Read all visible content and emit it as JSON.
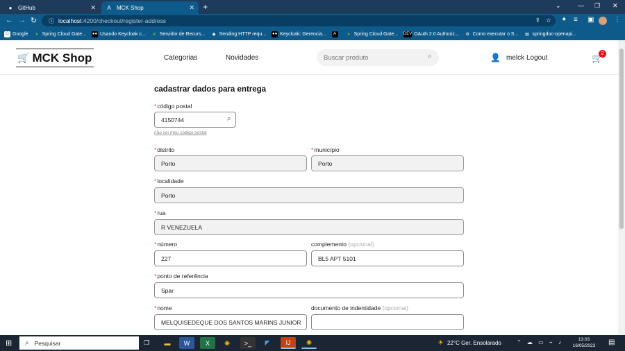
{
  "browser": {
    "tabs": [
      {
        "title": "GitHub",
        "icon": "github-icon",
        "close": "✕"
      },
      {
        "title": "MCK Shop",
        "icon": "angular-icon",
        "close": "✕"
      }
    ],
    "new_tab": "+",
    "window_controls": [
      "⌄",
      "—",
      "❐",
      "✕"
    ],
    "url_host": "localhost",
    "url_path": ":4200/checkout/register-address",
    "bookmarks": [
      {
        "label": "Google",
        "icon": "google-icon",
        "color": "#ffffff"
      },
      {
        "label": "Spring Cloud Gate...",
        "icon": "spring-icon",
        "color": "#6db33f"
      },
      {
        "label": "Usando Keycloak c...",
        "icon": "medium-icon",
        "color": "#000000"
      },
      {
        "label": "Servidor de Recurs...",
        "icon": "leaf-icon",
        "color": "#6db33f"
      },
      {
        "label": "Sending HTTP requ...",
        "icon": "bookmark-icon",
        "color": "#ffffff"
      },
      {
        "label": "Keycloak: Gerencia...",
        "icon": "medium-icon",
        "color": "#000000"
      },
      {
        "label": "",
        "icon": "angular-icon",
        "color": "#000000"
      },
      {
        "label": "Spring Cloud Gate...",
        "icon": "spring-icon",
        "color": "#6db33f"
      },
      {
        "label": "OAuth 2.0 Authoriz...",
        "icon": "dev-icon",
        "color": "#000000"
      },
      {
        "label": "Como executar o S...",
        "icon": "link-icon",
        "color": "#ffffff"
      },
      {
        "label": "springdoc-openapi...",
        "icon": "doc-icon",
        "color": "#ffffff"
      }
    ]
  },
  "header": {
    "brand": "MCK Shop",
    "nav": [
      "Categorias",
      "Novidades"
    ],
    "search_placeholder": "Buscar produto",
    "username": "melck",
    "logout": "Logout",
    "cart_count": "2"
  },
  "form": {
    "title": "cadastrar dados para entrega",
    "required_mark": "*",
    "postal_code": {
      "label": "código postal",
      "value": "4150744",
      "hint": "não sei meu código postal"
    },
    "district": {
      "label": "distrito",
      "value": "Porto"
    },
    "municipality": {
      "label": "município",
      "value": "Porto"
    },
    "locality": {
      "label": "localidade",
      "value": "Porto"
    },
    "street": {
      "label": "rua",
      "value": "R VENEZUELA"
    },
    "number": {
      "label": "número",
      "value": "227"
    },
    "complement": {
      "label": "complemento",
      "optional": "(opcional)",
      "value": "BL5 APT 5101"
    },
    "reference": {
      "label": "ponto de referência",
      "value": "Spar"
    },
    "name": {
      "label": "nome",
      "value": "MELQUISEDEQUE DOS SANTOS MARINS JUNIOR"
    },
    "id_document": {
      "label": "documento de indentidade",
      "optional": "(opcional)",
      "value": ""
    }
  },
  "taskbar": {
    "search_placeholder": "Pesquisar",
    "weather": "22°C  Ger. Ensolarado",
    "time": "13:03",
    "date": "16/05/2023"
  }
}
